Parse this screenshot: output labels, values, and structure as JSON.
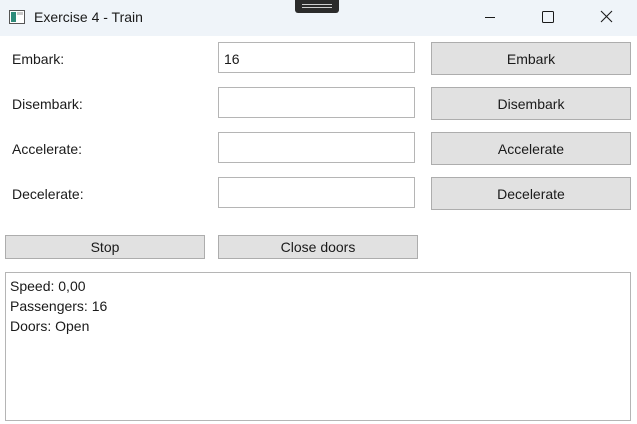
{
  "window": {
    "title": "Exercise 4 - Train"
  },
  "form": {
    "embark_label": "Embark:",
    "embark_value": "16",
    "embark_button": "Embark",
    "disembark_label": "Disembark:",
    "disembark_value": "",
    "disembark_button": "Disembark",
    "accelerate_label": "Accelerate:",
    "accelerate_value": "",
    "accelerate_button": "Accelerate",
    "decelerate_label": "Decelerate:",
    "decelerate_value": "",
    "decelerate_button": "Decelerate",
    "stop_button": "Stop",
    "close_doors_button": "Close doors"
  },
  "output": {
    "lines": [
      "Speed: 0,00",
      "Passengers: 16",
      "Doors: Open"
    ]
  },
  "icons": {
    "app": "window-app-icon",
    "minimize": "minimize-icon",
    "maximize": "maximize-icon",
    "close": "close-icon"
  },
  "colors": {
    "titlebar": "#eff4f9",
    "button_face": "#e1e1e1",
    "button_border": "#adadad",
    "textbox_border": "#b5b5b5"
  }
}
